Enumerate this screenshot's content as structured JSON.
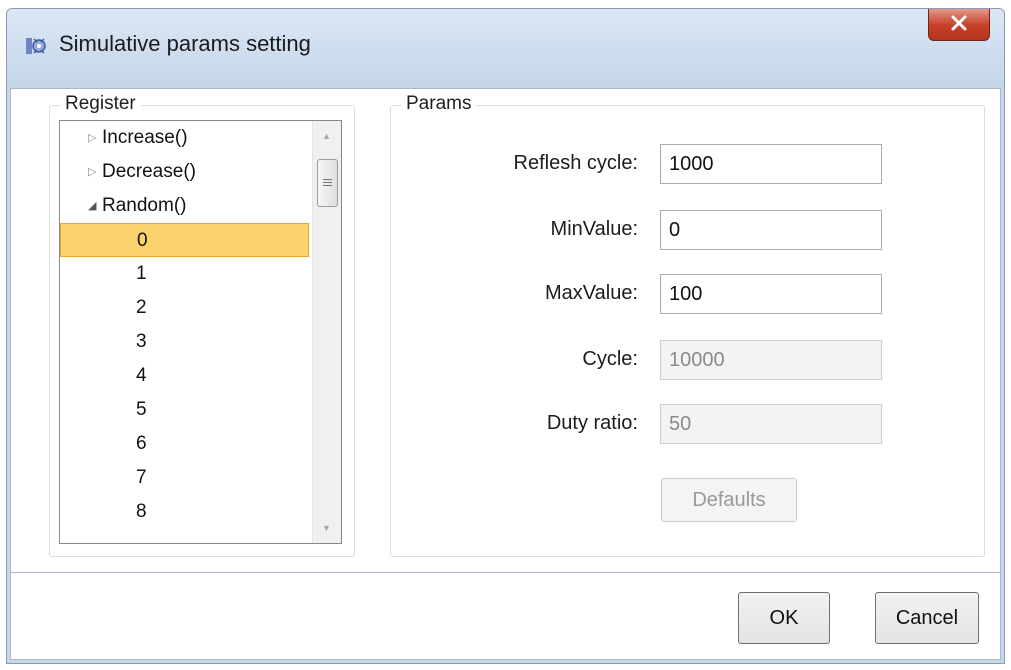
{
  "window": {
    "title": "Simulative params setting",
    "icon": "app-settings-icon",
    "close_icon": "close-icon"
  },
  "register": {
    "label": "Register",
    "tree": {
      "increase": "Increase()",
      "decrease": "Decrease()",
      "random": "Random()",
      "random_children": [
        "0",
        "1",
        "2",
        "3",
        "4",
        "5",
        "6",
        "7",
        "8"
      ],
      "selected": "0"
    }
  },
  "params": {
    "label": "Params",
    "reflesh_cycle": {
      "label": "Reflesh cycle:",
      "value": "1000"
    },
    "min_value": {
      "label": "MinValue:",
      "value": "0"
    },
    "max_value": {
      "label": "MaxValue:",
      "value": "100"
    },
    "cycle": {
      "label": "Cycle:",
      "value": "10000"
    },
    "duty_ratio": {
      "label": "Duty ratio:",
      "value": "50"
    },
    "defaults_label": "Defaults"
  },
  "footer": {
    "ok_label": "OK",
    "cancel_label": "Cancel"
  },
  "colors": {
    "selection": "#fbd26b",
    "close_button": "#c7412a",
    "title_bar": "#c4d6ea"
  }
}
